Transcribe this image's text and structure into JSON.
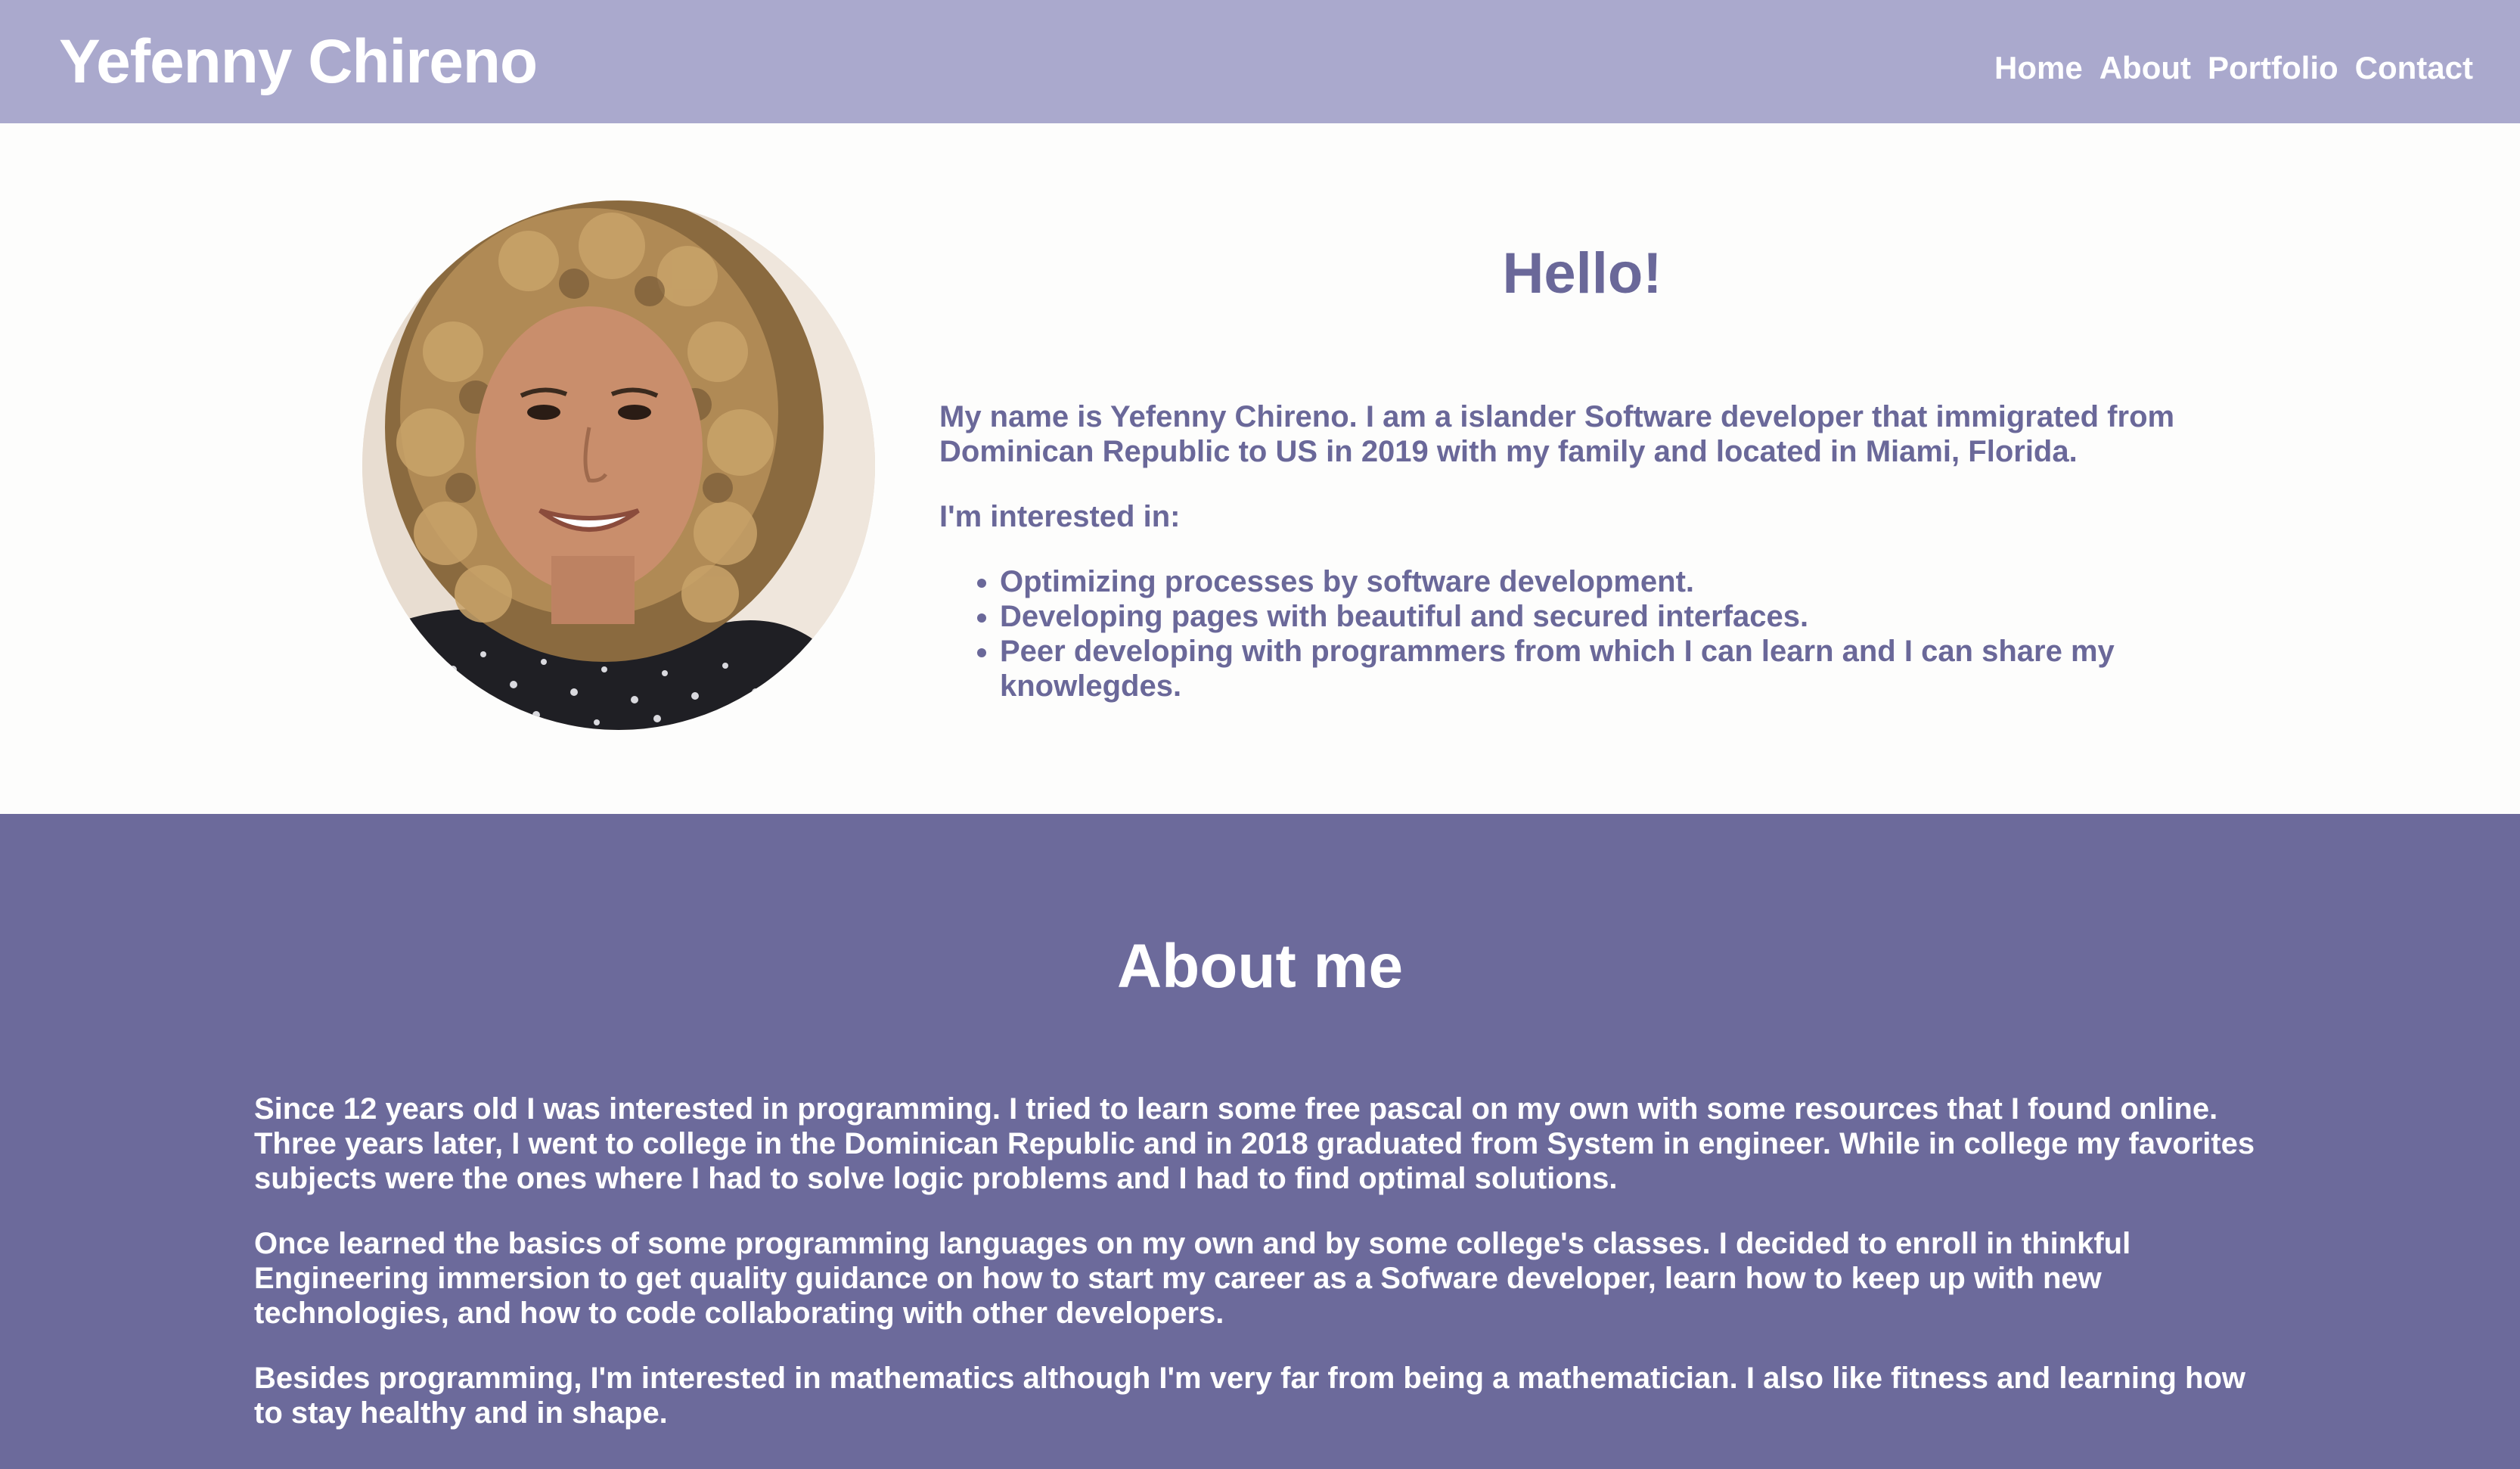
{
  "header": {
    "brand": "Yefenny Chireno",
    "nav": [
      {
        "label": "Home"
      },
      {
        "label": "About"
      },
      {
        "label": "Portfolio"
      },
      {
        "label": "Contact"
      }
    ]
  },
  "intro": {
    "title": "Hello!",
    "paragraph": "My name is Yefenny Chireno. I am a islander Software developer that immigrated from Dominican Republic to US in 2019 with my family and located in Miami, Florida.",
    "interests_label": "I'm interested in:",
    "interests": [
      "Optimizing processes by software development.",
      "Developing pages with beautiful and secured interfaces.",
      "Peer developing with programmers from which I can learn and I can share my knowlegdes."
    ]
  },
  "about": {
    "title": "About me",
    "paragraphs": [
      "Since 12 years old I was interested in programming. I tried to learn some free pascal on my own with some resources that I found online. Three years later, I went to college in the Dominican Republic and in 2018 graduated from System in engineer. While in college my favorites subjects were the ones where I had to solve logic problems and I had to find optimal solutions.",
      "Once learned the basics of some programming languages on my own and by some college's classes. I decided to enroll in thinkful Engineering immersion to get quality guidance on how to start my career as a Sofware developer, learn how to keep up with new technologies, and how to code collaborating with other developers.",
      "Besides programming, I'm interested in mathematics although I'm very far from being a mathematician. I also like fitness and learning how to stay healthy and in shape."
    ]
  },
  "colors": {
    "header_bg": "#aaa9cd",
    "accent_text": "#6a6899",
    "about_bg": "#6c6a9b",
    "page_bg": "#fdfdfc"
  }
}
